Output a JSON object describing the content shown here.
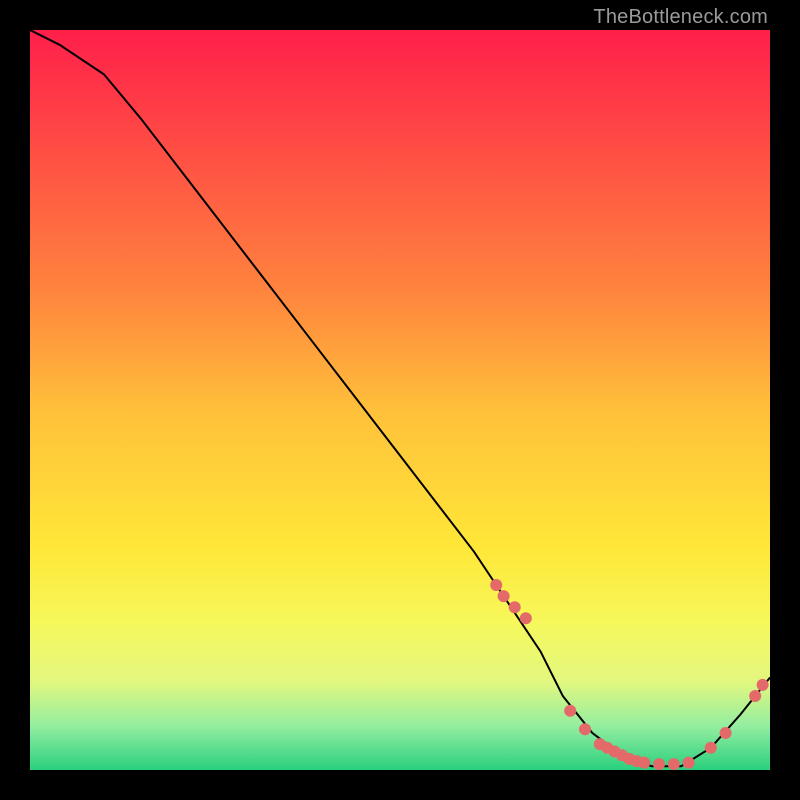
{
  "watermark": "TheBottleneck.com",
  "chart_data": {
    "type": "line",
    "title": "",
    "xlabel": "",
    "ylabel": "",
    "xlim": [
      0,
      100
    ],
    "ylim": [
      0,
      100
    ],
    "x": [
      0,
      4,
      10,
      15,
      20,
      25,
      30,
      35,
      40,
      45,
      50,
      55,
      60,
      63,
      66,
      69,
      72,
      76,
      80,
      84,
      88,
      92,
      96,
      100
    ],
    "y": [
      100,
      98,
      94,
      88,
      81.5,
      75,
      68.5,
      62,
      55.5,
      49,
      42.5,
      36,
      29.5,
      25,
      20.5,
      16,
      10,
      5,
      2,
      0.5,
      0.5,
      3,
      7.5,
      12.5
    ],
    "point_cluster_x": [
      63,
      64,
      65.5,
      67,
      73,
      75,
      77,
      78,
      79,
      80,
      81,
      82,
      83,
      85,
      87,
      89,
      92,
      94,
      98,
      99
    ],
    "point_cluster_y": [
      25,
      23.5,
      22,
      20.5,
      8,
      5.5,
      3.5,
      3,
      2.5,
      2,
      1.5,
      1.2,
      1,
      0.8,
      0.8,
      1,
      3,
      5,
      10,
      11.5
    ],
    "gradient_legend": {
      "top": "red (poor)",
      "middle": "yellow (neutral)",
      "bottom": "green (good)"
    }
  },
  "colors": {
    "gradient_stops": [
      {
        "offset": 0,
        "color": "#ff1f4a"
      },
      {
        "offset": 35,
        "color": "#ff833e"
      },
      {
        "offset": 52,
        "color": "#ffc23a"
      },
      {
        "offset": 70,
        "color": "#ffe738"
      },
      {
        "offset": 80,
        "color": "#f6f85b"
      },
      {
        "offset": 88,
        "color": "#e3f77f"
      },
      {
        "offset": 94,
        "color": "#94eea0"
      },
      {
        "offset": 100,
        "color": "#29d07e"
      }
    ],
    "point_fill": "#e46a6a",
    "line": "#000000"
  }
}
